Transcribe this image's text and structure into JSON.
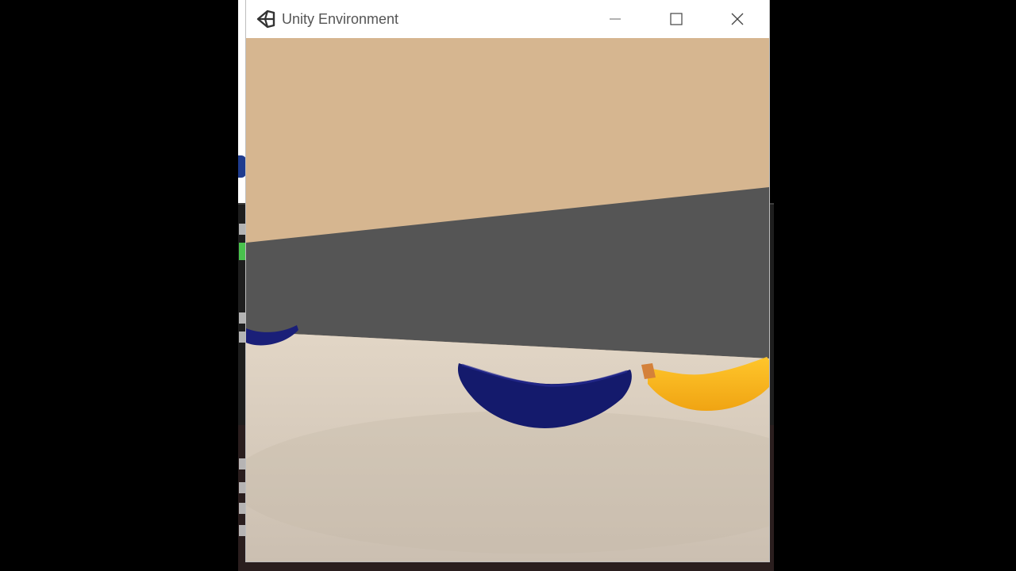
{
  "window": {
    "title": "Unity Environment",
    "icon": "unity-logo-icon",
    "controls": [
      "minimize-icon",
      "maximize-icon",
      "close-icon"
    ]
  },
  "scene": {
    "colors": {
      "sky": "#d6b690",
      "wall": "#555555",
      "floor": "#d8ccbc",
      "blue_banana": "#151a6e",
      "yellow_banana": "#f5b11d"
    },
    "objects": [
      "blue-banana",
      "blue-banana",
      "yellow-banana"
    ]
  }
}
